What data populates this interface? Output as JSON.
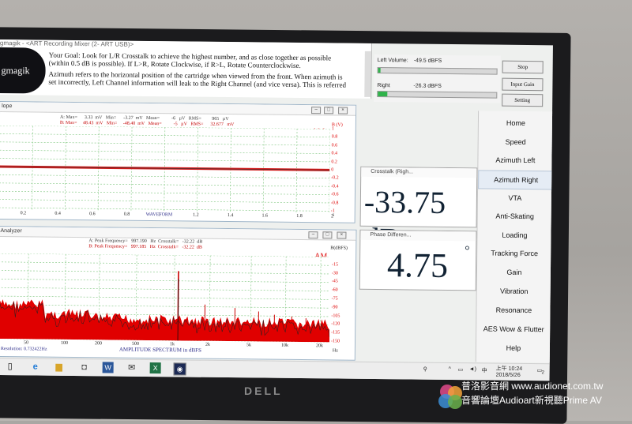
{
  "app": {
    "title": "gmagik - <ART Recording Mixer (2- ART USB)>",
    "logo_text": "gmagik"
  },
  "goal": {
    "line1": "Your Goal: Look for L/R Crosstalk to achieve the highest number, and as close together as possible",
    "line2": "(within 0.5 dB is possible).  If L>R, Rotate Clockwise, if R>L, Rotate Counterclockwise.",
    "line3": "Azimuth refers to the horizontal position of the cartridge when viewed from the front.   When azimuth is",
    "line4": "set incorrectly, Left Channel information will leak to the Right Channel (and vice versa). This is referred"
  },
  "volume": {
    "left_label": "Left Volume:",
    "left_value": "-49.5 dBFS",
    "left_fill": 0.02,
    "right_label": "Right",
    "right_value": "-26.3 dBFS",
    "right_fill": 0.08
  },
  "side_buttons": [
    "Stop",
    "Input Gain",
    "Setting"
  ],
  "nav": {
    "items": [
      "Home",
      "Speed",
      "Azimuth Left",
      "Azimuth Right",
      "VTA",
      "Anti-Skating",
      "Loading",
      "Tracking Force",
      "Gain",
      "Vibration",
      "Resonance",
      "AES Wow & Flutter",
      "Help"
    ],
    "selected": "Azimuth Right"
  },
  "scope": {
    "title": "lope",
    "stats_a": "A: Max=      3.33  mV   Min=      -3.27  mV   Mean=          -6   µV   RMS=         965   µV",
    "stats_b": "B: Max=     48.43  mV   Min=     -48.40  mV   Mean=          -5   µV   RMS=      32.677   mV",
    "brand": "AM",
    "x_ticks": [
      "0.2",
      "0.4",
      "0.6",
      "0.8",
      "1",
      "1.2",
      "1.4",
      "1.6",
      "1.8",
      "2"
    ],
    "x_label": "WAVEFORM",
    "x_unit": "s",
    "y_unit": "B (V)",
    "y_ticks": [
      "1",
      "0.8",
      "0.6",
      "0.4",
      "0.2",
      "0",
      "-0.2",
      "-0.4",
      "-0.6",
      "-0.8",
      "-1"
    ]
  },
  "analyzer": {
    "title": "Analyzer",
    "stats_a": "A: Peak Frequency=   997.190   Hz  Crosstalk=   -32.22  dB",
    "stats_b": "B: Peak Frequency=   997.185   Hz  Crosstalk=   -32.22  dB",
    "brand": "AM",
    "x_ticks": [
      "50",
      "100",
      "200",
      "500",
      "1k",
      "2k",
      "5k",
      "10k",
      "20k"
    ],
    "x_label": "AMPLITUDE SPECTRUM in dBFS",
    "x_unit": "Hz",
    "resolution": "Resolution: 0.732422Hz",
    "y_unit": "B(dBFS)",
    "y_ticks": [
      "-15",
      "-30",
      "-45",
      "-60",
      "-75",
      "-90",
      "-105",
      "-120",
      "-135",
      "-150"
    ]
  },
  "crosstalk_window": {
    "title": "Crosstalk (Righ...",
    "value": "-33.75 dB"
  },
  "phase_window": {
    "title": "Phase Differen...",
    "value": "4.75",
    "unit": "°"
  },
  "taskbar": {
    "time": "上午 10:24",
    "date": "2018/5/26",
    "lang": "中",
    "notif": "2"
  },
  "bezel_brand": "DELL",
  "watermark": {
    "line1": "普洛影音網 www.audionet.com.tw",
    "line2": "音響論壇Audioart新視聽Prime AV"
  }
}
